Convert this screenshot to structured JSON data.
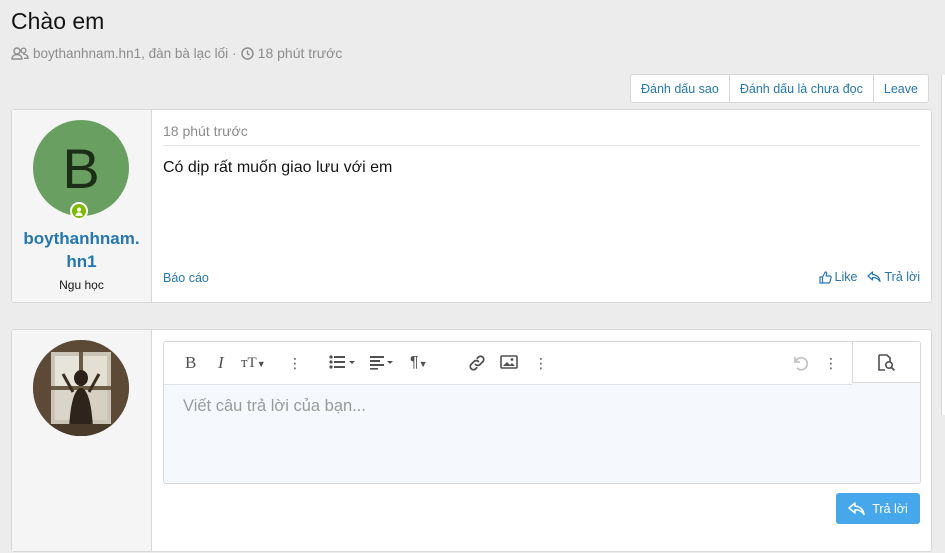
{
  "thread": {
    "title": "Chào em",
    "participants": "boythanhnam.hn1, đàn bà lạc lối",
    "separator": "·",
    "time": "18 phút trước"
  },
  "thread_actions": {
    "star": "Đánh dấu sao",
    "mark_unread": "Đánh dấu là chưa đọc",
    "leave": "Leave"
  },
  "message": {
    "avatar_letter": "B",
    "username": "boythanhnam.hn1",
    "user_title": "Ngu học",
    "time": "18 phút trước",
    "body": "Có dịp rất muốn giao lưu với em",
    "report": "Báo cáo",
    "like": "Like",
    "reply": "Trả lời"
  },
  "reply_form": {
    "placeholder": "Viết câu trả lời của bạn...",
    "submit": "Trả lời"
  }
}
